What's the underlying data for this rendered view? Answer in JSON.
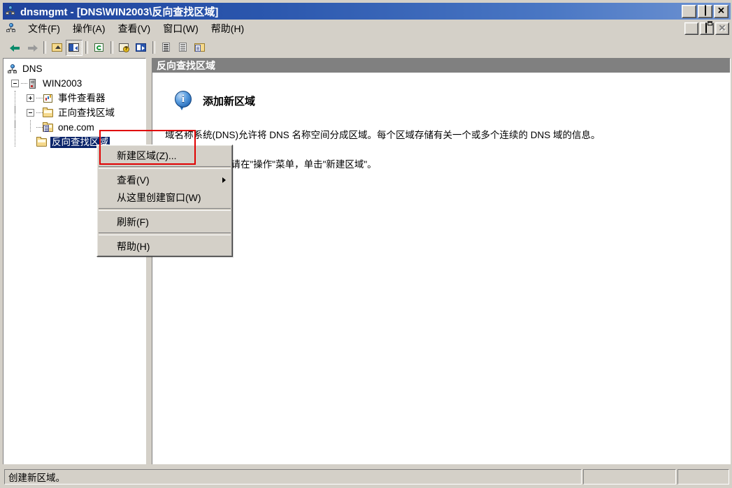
{
  "window": {
    "title": "dnsmgmt - [DNS\\WIN2003\\反向查找区域]",
    "icon": "dns-console-icon",
    "buttons": {
      "minimize": "minimize-icon",
      "maximize": "maximize-icon",
      "close": "close-icon"
    }
  },
  "menubar": {
    "icon": "dns-console-icon",
    "items": [
      {
        "label": "文件(F)",
        "name": "menu-file"
      },
      {
        "label": "操作(A)",
        "name": "menu-action"
      },
      {
        "label": "查看(V)",
        "name": "menu-view"
      },
      {
        "label": "窗口(W)",
        "name": "menu-window"
      },
      {
        "label": "帮助(H)",
        "name": "menu-help"
      }
    ],
    "mdi_buttons": {
      "minimize": "minimize-icon",
      "restore": "restore-icon",
      "close": "close-icon-disabled"
    }
  },
  "toolbar": {
    "buttons": [
      {
        "name": "back-button",
        "icon": "arrow-left-icon",
        "enabled": true
      },
      {
        "name": "forward-button",
        "icon": "arrow-right-icon",
        "enabled": false
      },
      {
        "name": "up-one-level-button",
        "icon": "up-folder-icon",
        "enabled": true
      },
      {
        "name": "show-hide-tree-button",
        "icon": "console-tree-icon",
        "pressed": true
      },
      {
        "name": "refresh-button",
        "icon": "refresh-icon",
        "enabled": true
      },
      {
        "name": "help-button",
        "icon": "help-icon",
        "enabled": true
      },
      {
        "name": "properties-button",
        "icon": "properties-icon",
        "enabled": true
      },
      {
        "name": "list-view-button",
        "icon": "list-icon",
        "enabled": true
      },
      {
        "name": "detail-view-button",
        "icon": "detail-list-icon",
        "enabled": true
      },
      {
        "name": "export-list-button",
        "icon": "folder-document-icon",
        "enabled": true
      }
    ]
  },
  "tree": {
    "nodes": [
      {
        "label": "DNS",
        "icon": "dns-root-icon",
        "level": 0,
        "expander": "none",
        "selected": false
      },
      {
        "label": "WIN2003",
        "icon": "server-icon",
        "level": 1,
        "expander": "minus",
        "selected": false
      },
      {
        "label": "事件查看器",
        "icon": "event-viewer-icon",
        "level": 2,
        "expander": "plus",
        "selected": false
      },
      {
        "label": "正向查找区域",
        "icon": "folder-icon",
        "level": 2,
        "expander": "minus",
        "selected": false
      },
      {
        "label": "one.com",
        "icon": "zone-folder-icon",
        "level": 3,
        "expander": "none",
        "selected": false
      },
      {
        "label": "反向查找区域",
        "icon": "folder-icon",
        "level": 2,
        "expander": "none",
        "selected": true
      }
    ]
  },
  "right_pane": {
    "header": "反向查找区域",
    "info_icon": "info-icon",
    "title": "添加新区域",
    "paragraph1": "域名称系统(DNS)允许将 DNS 名称空间分成区域。每个区域存储有关一个或多个连续的 DNS 域的信息。",
    "paragraph2": "要添加新区域，请在\"操作\"菜单，单击\"新建区域\"。"
  },
  "context_menu": {
    "items": [
      {
        "label": "新建区域(Z)...",
        "name": "ctx-new-zone",
        "submenu": false,
        "highlighted": true
      },
      {
        "separator": true
      },
      {
        "label": "查看(V)",
        "name": "ctx-view",
        "submenu": true
      },
      {
        "label": "从这里创建窗口(W)",
        "name": "ctx-new-window-from-here",
        "submenu": false
      },
      {
        "separator": true
      },
      {
        "label": "刷新(F)",
        "name": "ctx-refresh",
        "submenu": false
      },
      {
        "separator": true
      },
      {
        "label": "帮助(H)",
        "name": "ctx-help",
        "submenu": false
      }
    ]
  },
  "annotation": {
    "color": "#e00000",
    "target": "新建区域(Z)..."
  },
  "statusbar": {
    "message": "创建新区域。",
    "panel2": "",
    "panel3": ""
  },
  "colors": {
    "titlebar_start": "#20439c",
    "titlebar_end": "#6e93d2",
    "chrome": "#d4d0c8",
    "pane_header": "#808080",
    "selection": "#0a246a",
    "annotation_red": "#e00000"
  }
}
